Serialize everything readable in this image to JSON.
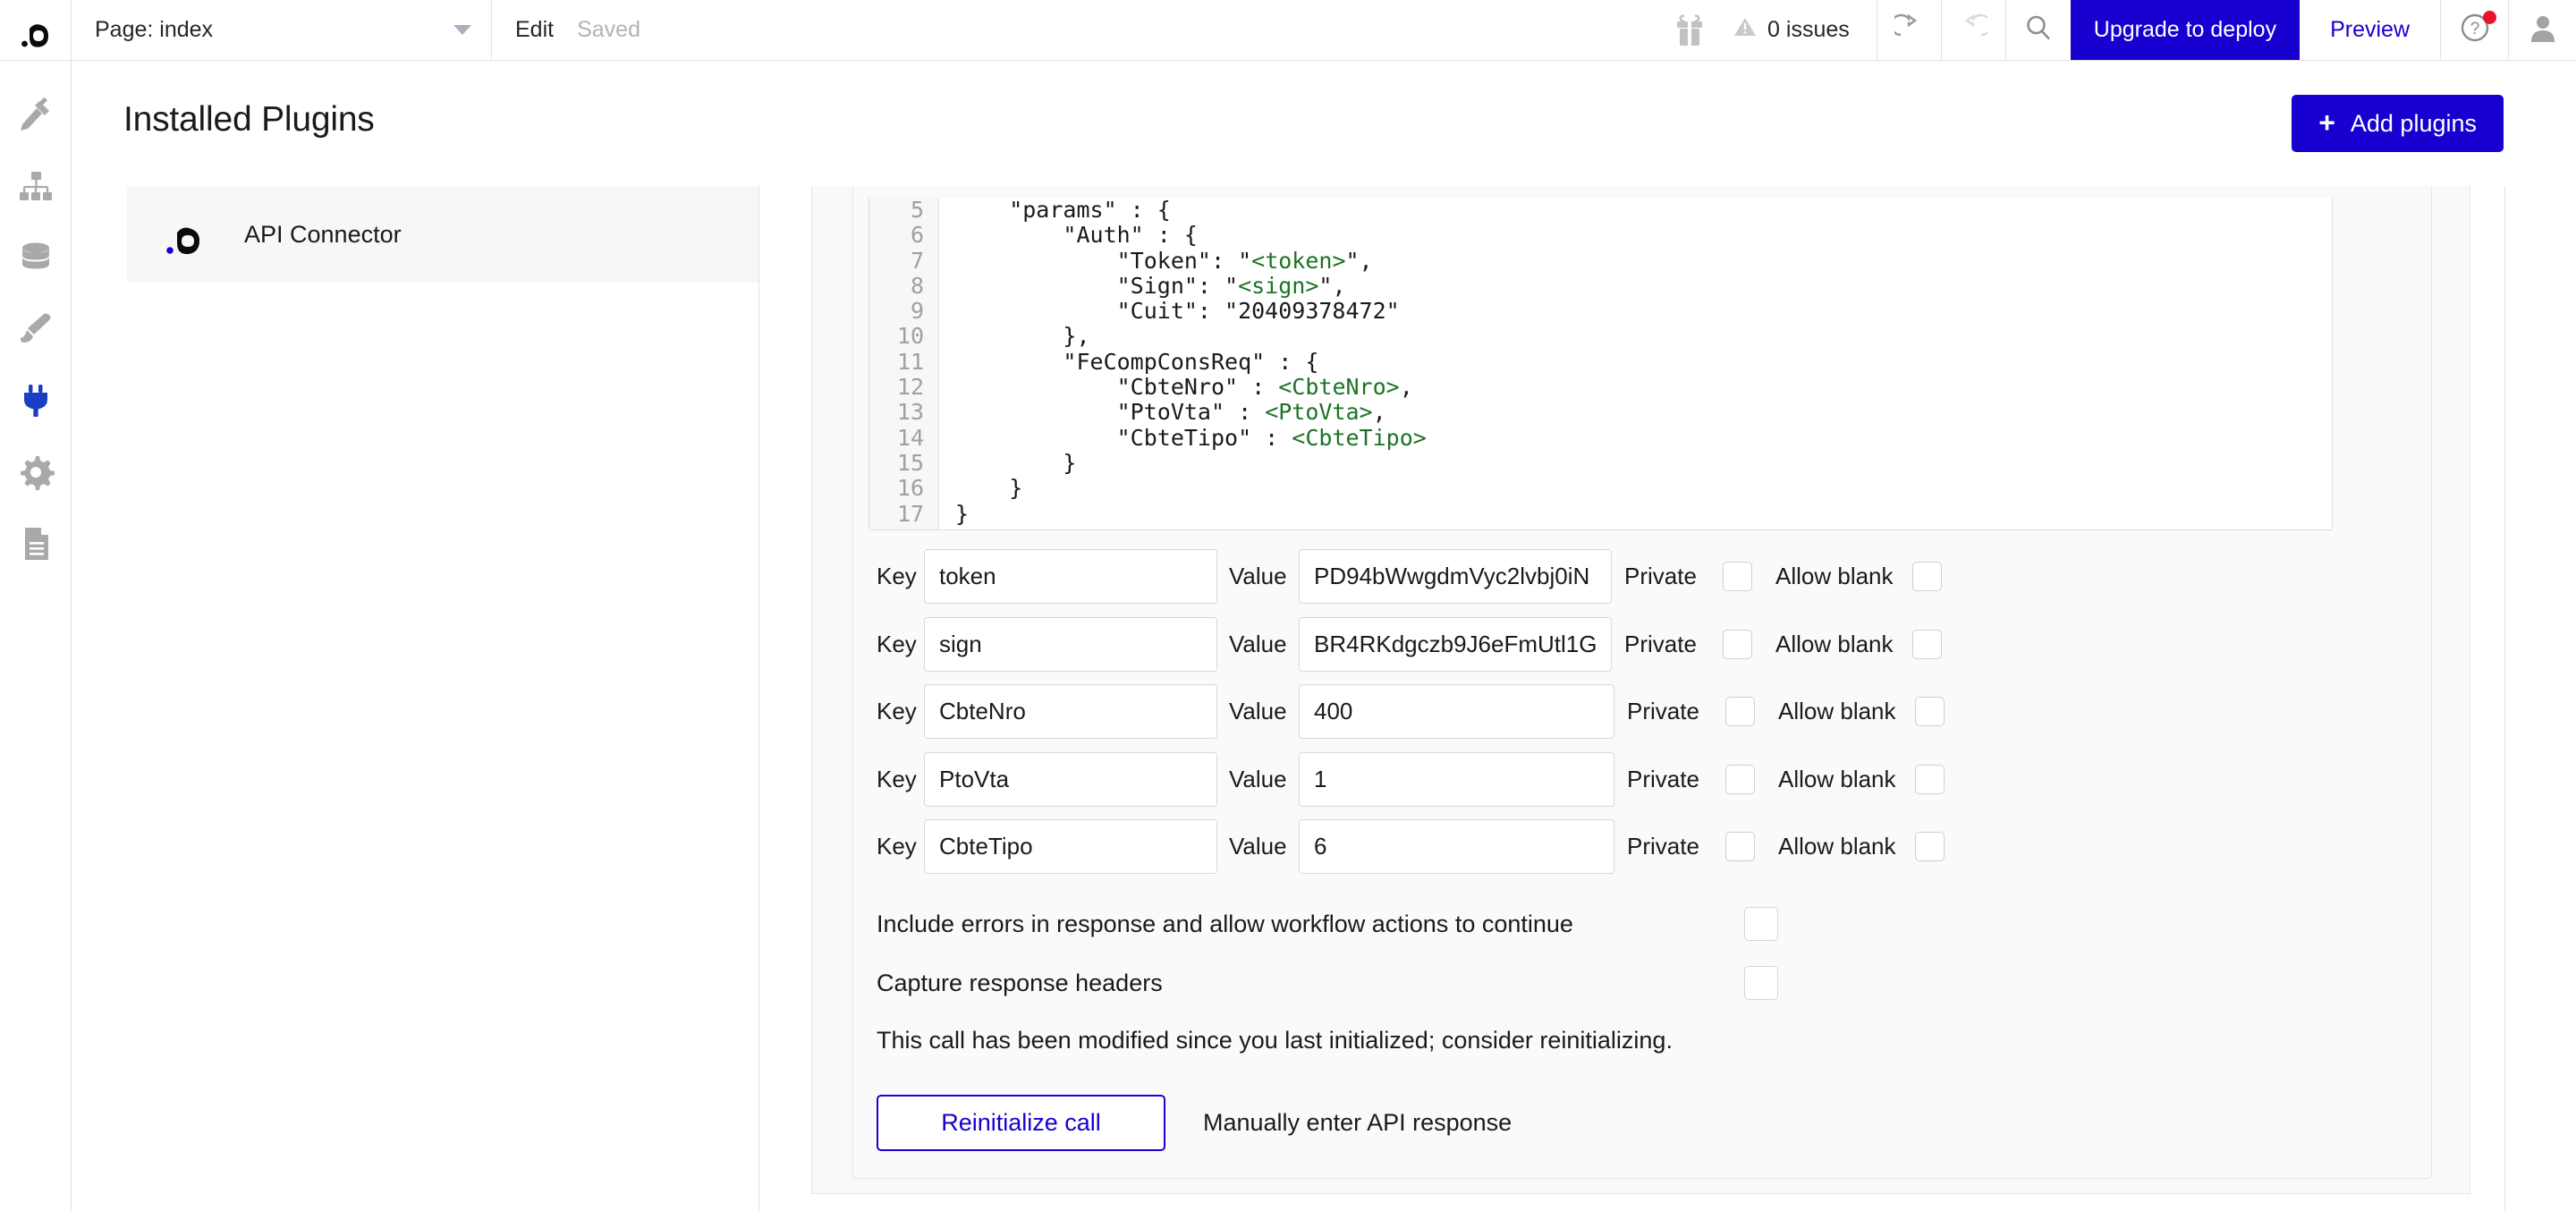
{
  "topbar": {
    "logo_icon": "bubble-logo-icon",
    "page_selector_label": "Page: index",
    "caret_icon": "chevron-down-icon",
    "edit_label": "Edit",
    "saved_label": "Saved",
    "gift_icon": "gift-icon",
    "warning_icon": "warning-triangle-icon",
    "issues_label": "0 issues",
    "undo_icon": "undo-icon",
    "redo_icon": "redo-icon",
    "search_icon": "search-icon",
    "upgrade_label": "Upgrade to deploy",
    "preview_label": "Preview",
    "help_icon": "help-circle-icon",
    "avatar_icon": "user-avatar-icon",
    "accent_color": "#1700d0",
    "notification_dot_color": "#e8142b"
  },
  "sidebar": {
    "items": [
      {
        "name": "design",
        "icon": "pencil-ruler-icon",
        "active": false
      },
      {
        "name": "workflow",
        "icon": "workflow-hierarchy-icon",
        "active": false
      },
      {
        "name": "data",
        "icon": "database-icon",
        "active": false
      },
      {
        "name": "styles",
        "icon": "paintbrush-icon",
        "active": false
      },
      {
        "name": "plugins",
        "icon": "plug-icon",
        "active": true
      },
      {
        "name": "settings",
        "icon": "gear-icon",
        "active": false
      },
      {
        "name": "logs",
        "icon": "document-lines-icon",
        "active": false
      }
    ],
    "active_color": "#1a3fc4",
    "inactive_color": "#a9a9a9"
  },
  "page": {
    "title": "Installed Plugins",
    "add_plugins_label": "Add plugins",
    "add_plugins_icon": "plus-icon"
  },
  "plugins": {
    "items": [
      {
        "name": "API Connector",
        "icon": "bubble-logo-icon",
        "selected": true
      }
    ]
  },
  "code_editor": {
    "language": "json",
    "first_visible_line": 5,
    "lines": [
      {
        "num": "5",
        "segments": [
          {
            "t": "    \"params\" : {",
            "cls": ""
          }
        ]
      },
      {
        "num": "6",
        "segments": [
          {
            "t": "        \"Auth\" : {",
            "cls": ""
          }
        ]
      },
      {
        "num": "7",
        "segments": [
          {
            "t": "            \"Token\": \"",
            "cls": ""
          },
          {
            "t": "<token>",
            "cls": "tok-var"
          },
          {
            "t": "\",",
            "cls": ""
          }
        ]
      },
      {
        "num": "8",
        "segments": [
          {
            "t": "            \"Sign\": \"",
            "cls": ""
          },
          {
            "t": "<sign>",
            "cls": "tok-var"
          },
          {
            "t": "\",",
            "cls": ""
          }
        ]
      },
      {
        "num": "9",
        "segments": [
          {
            "t": "            \"Cuit\": \"20409378472\"",
            "cls": ""
          }
        ]
      },
      {
        "num": "10",
        "segments": [
          {
            "t": "        },",
            "cls": ""
          }
        ]
      },
      {
        "num": "11",
        "segments": [
          {
            "t": "        \"FeCompConsReq\" : {",
            "cls": ""
          }
        ]
      },
      {
        "num": "12",
        "segments": [
          {
            "t": "            \"CbteNro\" : ",
            "cls": ""
          },
          {
            "t": "<CbteNro>",
            "cls": "tok-var"
          },
          {
            "t": ",",
            "cls": ""
          }
        ]
      },
      {
        "num": "13",
        "segments": [
          {
            "t": "            \"PtoVta\" : ",
            "cls": ""
          },
          {
            "t": "<PtoVta>",
            "cls": "tok-var"
          },
          {
            "t": ",",
            "cls": ""
          }
        ]
      },
      {
        "num": "14",
        "segments": [
          {
            "t": "            \"CbteTipo\" : ",
            "cls": ""
          },
          {
            "t": "<CbteTipo>",
            "cls": "tok-var"
          }
        ]
      },
      {
        "num": "15",
        "segments": [
          {
            "t": "        }",
            "cls": ""
          }
        ]
      },
      {
        "num": "16",
        "segments": [
          {
            "t": "    }",
            "cls": ""
          }
        ]
      },
      {
        "num": "17",
        "segments": [
          {
            "t": "}",
            "cls": ""
          }
        ]
      }
    ],
    "variable_color": "#1d7324"
  },
  "parameters": {
    "key_label": "Key",
    "value_label": "Value",
    "private_label": "Private",
    "allow_blank_label": "Allow blank",
    "rows": [
      {
        "key": "token",
        "value": "PD94bWwgdmVyc2lvbj0iN",
        "private": false,
        "allow_blank": false,
        "narrow": true
      },
      {
        "key": "sign",
        "value": "BR4RKdgczb9J6eFmUtl1G",
        "private": false,
        "allow_blank": false,
        "narrow": true
      },
      {
        "key": "CbteNro",
        "value": "400",
        "private": false,
        "allow_blank": false,
        "narrow": false
      },
      {
        "key": "PtoVta",
        "value": "1",
        "private": false,
        "allow_blank": false,
        "narrow": false
      },
      {
        "key": "CbteTipo",
        "value": "6",
        "private": false,
        "allow_blank": false,
        "narrow": false
      }
    ]
  },
  "options": [
    {
      "label": "Include errors in response and allow workflow actions to continue",
      "checked": false
    },
    {
      "label": "Capture response headers",
      "checked": false
    }
  ],
  "footer": {
    "modified_note": "This call has been modified since you last initialized; consider reinitializing.",
    "reinitialize_label": "Reinitialize call",
    "manual_response_label": "Manually enter API response"
  }
}
